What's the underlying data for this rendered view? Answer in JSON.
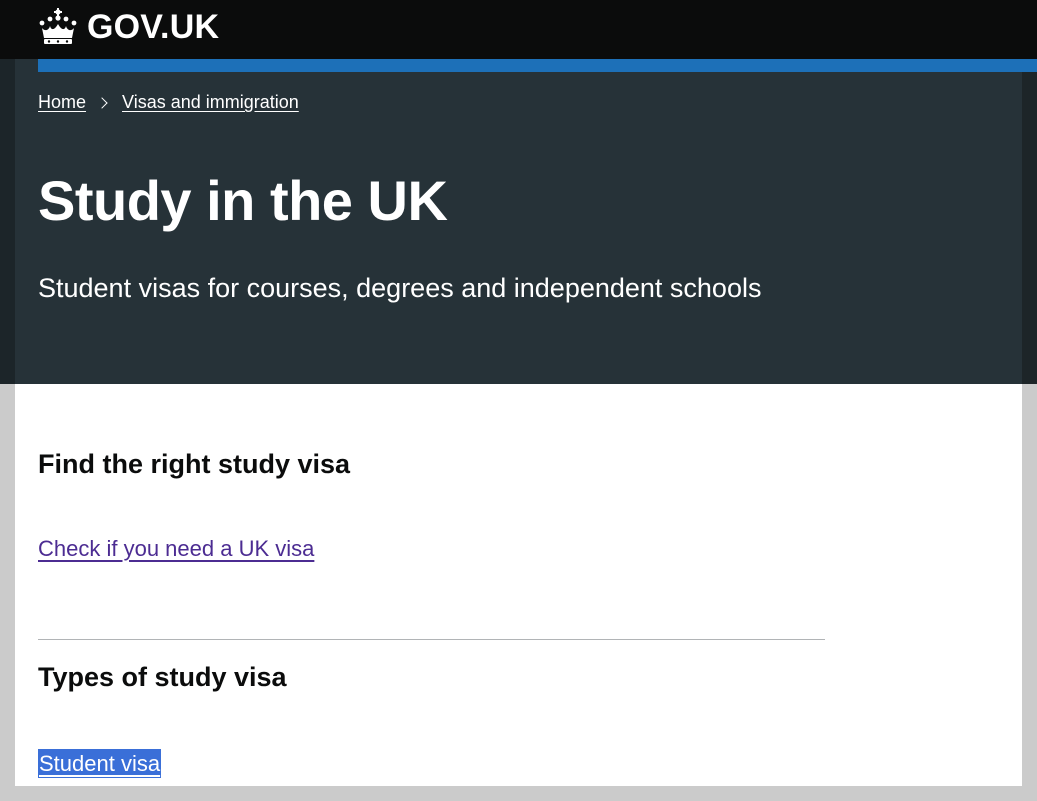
{
  "header": {
    "logo_text": "GOV.UK",
    "logo_icon": "crown-icon"
  },
  "breadcrumb": {
    "items": [
      {
        "label": "Home"
      },
      {
        "label": "Visas and immigration"
      }
    ]
  },
  "hero": {
    "title": "Study in the UK",
    "subtitle": "Student visas for courses, degrees and independent schools"
  },
  "sections": [
    {
      "heading": "Find the right study visa",
      "links": [
        {
          "label": "Check if you need a UK visa"
        }
      ]
    },
    {
      "heading": "Types of study visa",
      "links": [
        {
          "label": "Student visa",
          "selected": true
        }
      ]
    }
  ],
  "colors": {
    "header_bg": "#0b0c0c",
    "accent_blue": "#1d70b8",
    "hero_bg": "#263238",
    "link_visited": "#4c2c92",
    "selection": "#3a6fd8"
  }
}
